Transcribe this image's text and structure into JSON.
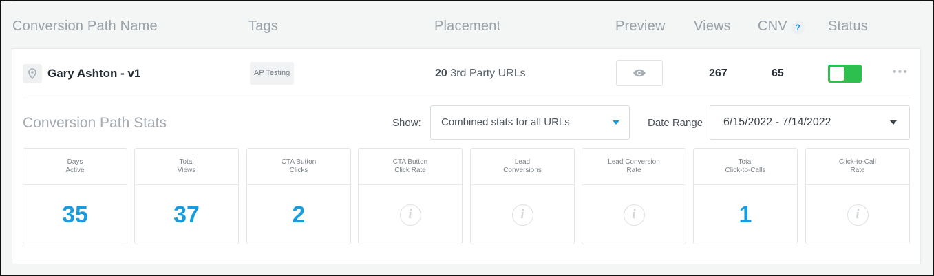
{
  "columns": {
    "name": "Conversion Path Name",
    "tags": "Tags",
    "placement": "Placement",
    "preview": "Preview",
    "views": "Views",
    "cnv": "CNV",
    "cnv_help": "?",
    "status": "Status"
  },
  "row": {
    "title": "Gary Ashton - v1",
    "tag": "AP Testing",
    "placement_count": "20",
    "placement_text": " 3rd Party URLs",
    "views": "267",
    "cnv": "65",
    "status_on": true,
    "menu": "•••"
  },
  "stats": {
    "title": "Conversion Path Stats",
    "show_label": "Show:",
    "show_value": "Combined stats for all URLs",
    "date_label": "Date Range",
    "date_value": "6/15/2022 - 7/14/2022",
    "tiles": [
      {
        "label": "Days\nActive",
        "value": "35"
      },
      {
        "label": "Total\nViews",
        "value": "37"
      },
      {
        "label": "CTA Button\nClicks",
        "value": "2"
      },
      {
        "label": "CTA Button\nClick Rate",
        "value": "i"
      },
      {
        "label": "Lead\nConversions",
        "value": "i"
      },
      {
        "label": "Lead Conversion\nRate",
        "value": "i"
      },
      {
        "label": "Total\nClick-to-Calls",
        "value": "1"
      },
      {
        "label": "Click-to-Call\nRate",
        "value": "i"
      }
    ]
  },
  "colors": {
    "accent": "#1a9bdc",
    "toggle_on": "#2ec04f"
  }
}
